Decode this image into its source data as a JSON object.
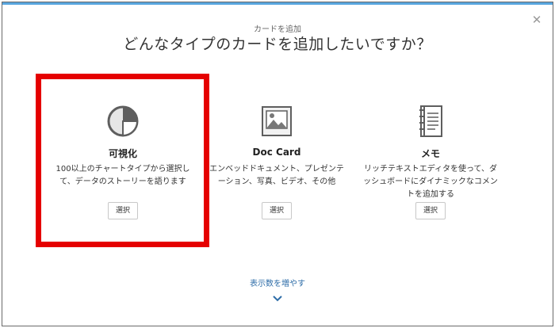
{
  "dialog": {
    "subtitle": "カードを追加",
    "title": "どんなタイプのカードを追加したいですか？",
    "close_icon": "close-icon"
  },
  "cards": [
    {
      "icon": "pie-chart-icon",
      "title": "可視化",
      "description": "100以上のチャートタイプから選択して、データのストーリーを語ります",
      "button_label": "選択",
      "highlighted": true
    },
    {
      "icon": "image-document-icon",
      "title": "Doc Card",
      "description": "エンベッドドキュメント、プレゼンテーション、写真、ビデオ、その他",
      "button_label": "選択",
      "highlighted": false
    },
    {
      "icon": "notebook-icon",
      "title": "メモ",
      "description": "リッチテキストエディタを使って、ダッシュボードにダイナミックなコメントを追加する",
      "button_label": "選択",
      "highlighted": false
    }
  ],
  "footer": {
    "more_label": "表示数を増やす",
    "chevron_icon": "chevron-down-icon"
  },
  "colors": {
    "highlight": "#e50000",
    "link": "#2e6da8",
    "topbar": "#58a6de"
  }
}
